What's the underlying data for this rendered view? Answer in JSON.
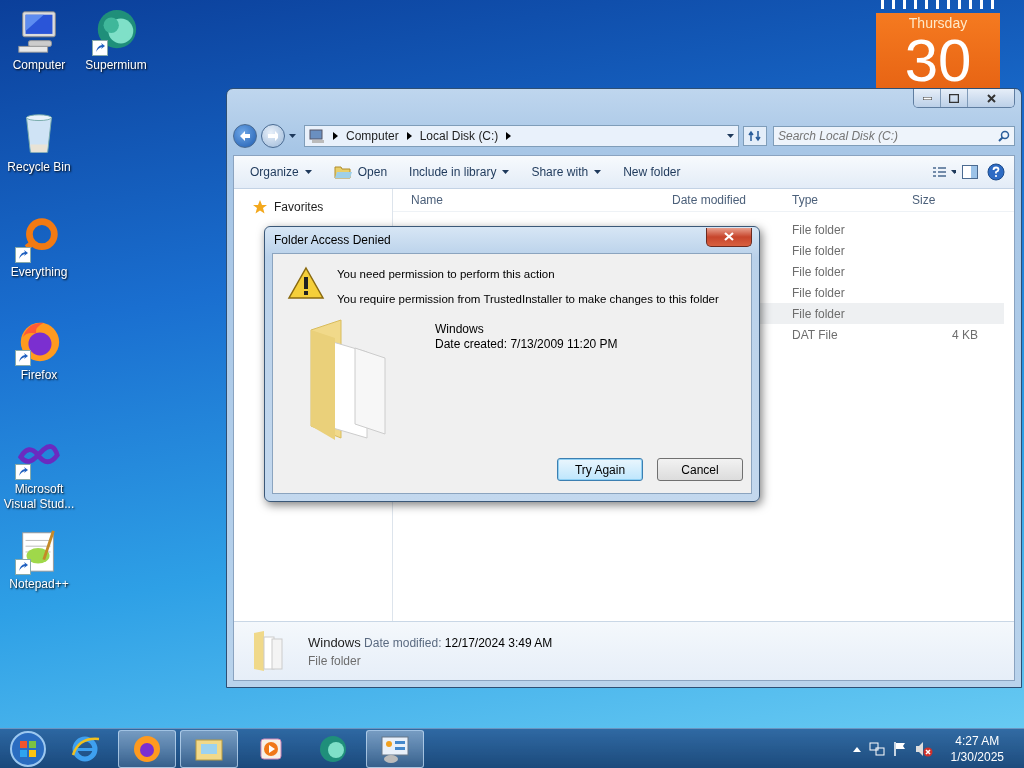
{
  "desktop_icons": [
    {
      "label": "Computer",
      "shortcut": false
    },
    {
      "label": "Supermium",
      "shortcut": true
    },
    {
      "label": "Recycle Bin",
      "shortcut": false
    },
    {
      "label": "Everything",
      "shortcut": true
    },
    {
      "label": "Firefox",
      "shortcut": true
    },
    {
      "label": "Microsoft Visual Stud...",
      "shortcut": true
    },
    {
      "label": "Notepad++",
      "shortcut": true
    }
  ],
  "calendar_gadget": {
    "weekday": "Thursday",
    "day": "30"
  },
  "explorer": {
    "breadcrumbs": [
      "Computer",
      "Local Disk (C:)"
    ],
    "search": {
      "placeholder": "Search Local Disk (C:)"
    },
    "toolbar": [
      {
        "label": "Organize",
        "dropdown": true
      },
      {
        "label": "Open",
        "dropdown": false
      },
      {
        "label": "Include in library",
        "dropdown": true
      },
      {
        "label": "Share with",
        "dropdown": true
      },
      {
        "label": "New folder",
        "dropdown": false
      }
    ],
    "nav": [
      {
        "label": "Favorites"
      }
    ],
    "columns": [
      "Name",
      "Date modified",
      "Type",
      "Size"
    ],
    "rows": [
      {
        "type": "File folder",
        "selected": false
      },
      {
        "type": "File folder",
        "selected": false
      },
      {
        "type": "File folder",
        "selected": false
      },
      {
        "type": "File folder",
        "selected": false
      },
      {
        "type": "File folder",
        "selected": true
      },
      {
        "type": "DAT File",
        "size": "4 KB",
        "selected": false
      }
    ],
    "details": {
      "name": "Windows",
      "date_label": "Date modified:",
      "date": "12/17/2024 3:49 AM",
      "type": "File folder"
    }
  },
  "dialog": {
    "title": "Folder Access Denied",
    "heading": "You need permission to perform this action",
    "message": "You require permission from TrustedInstaller to make changes to this folder",
    "item_name": "Windows",
    "item_date": "Date created: 7/13/2009 11:20 PM",
    "buttons": [
      {
        "label": "Try Again",
        "default": true
      },
      {
        "label": "Cancel",
        "default": false
      }
    ]
  },
  "taskbar": {
    "apps": [
      {
        "running": false
      },
      {
        "running": true
      },
      {
        "running": true
      },
      {
        "running": false
      },
      {
        "running": false
      },
      {
        "running": true
      }
    ],
    "time": "4:27 AM",
    "date": "1/30/2025"
  }
}
